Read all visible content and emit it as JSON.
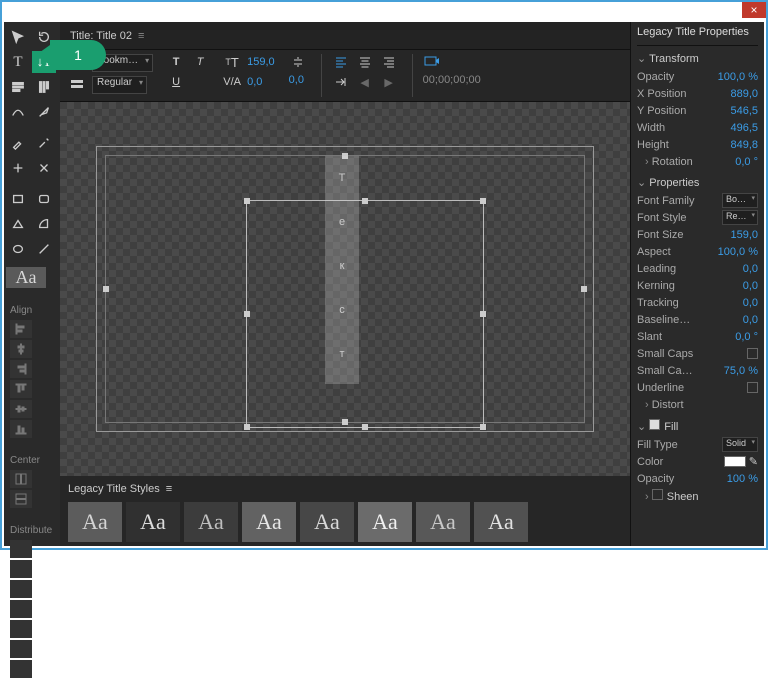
{
  "close": "×",
  "callout": "1",
  "title_tab": "Title: Title 02",
  "align_section": "Align",
  "center_section": "Center",
  "distribute_section": "Distribute",
  "font_family_sel": "Bookm…",
  "font_style_sel": "Regular",
  "font_size_val": "159,0",
  "kerning_val": "0,0",
  "leading_val": "0,0",
  "timecode": "00;00;00;00",
  "canvas_text": [
    "Т",
    "е",
    "к",
    "с",
    "т"
  ],
  "styles_header": "Legacy Title Styles",
  "style_preview": "Aa",
  "swatches": [
    {
      "bg": "#5c5c5c",
      "fg": "#d4d4d4"
    },
    {
      "bg": "#303030",
      "fg": "#dcdcdc"
    },
    {
      "bg": "#3c3c3c",
      "fg": "#bfbfbf"
    },
    {
      "bg": "#626262",
      "fg": "#e6e6e6"
    },
    {
      "bg": "#474747",
      "fg": "#d8d8d8"
    },
    {
      "bg": "#6b6b6b",
      "fg": "#f0f0f0"
    },
    {
      "bg": "#585858",
      "fg": "#c8c8c8"
    },
    {
      "bg": "#515151",
      "fg": "#e2e2e2"
    }
  ],
  "props_title": "Legacy Title Properties",
  "transform": {
    "label": "Transform",
    "opacity_l": "Opacity",
    "opacity_v": "100,0 %",
    "xpos_l": "X Position",
    "xpos_v": "889,0",
    "ypos_l": "Y Position",
    "ypos_v": "546,5",
    "width_l": "Width",
    "width_v": "496,5",
    "height_l": "Height",
    "height_v": "849,8",
    "rotation_l": "Rotation",
    "rotation_v": "0,0 °"
  },
  "properties": {
    "label": "Properties",
    "ff_l": "Font Family",
    "ff_v": "Bo…",
    "fs_l": "Font Style",
    "fs_v": "Re…",
    "fsize_l": "Font Size",
    "fsize_v": "159,0",
    "aspect_l": "Aspect",
    "aspect_v": "100,0 %",
    "leading_l": "Leading",
    "leading_v": "0,0",
    "kerning_l": "Kerning",
    "kerning_v": "0,0",
    "tracking_l": "Tracking",
    "tracking_v": "0,0",
    "baseline_l": "Baseline…",
    "baseline_v": "0,0",
    "slant_l": "Slant",
    "slant_v": "0,0 °",
    "scaps_l": "Small Caps",
    "scapss_l": "Small Ca…",
    "scapss_v": "75,0 %",
    "ul_l": "Underline",
    "distort_l": "Distort"
  },
  "fill": {
    "label": "Fill",
    "type_l": "Fill Type",
    "type_v": "Solid",
    "color_l": "Color",
    "opacity_l": "Opacity",
    "opacity_v": "100 %",
    "sheen_l": "Sheen"
  }
}
